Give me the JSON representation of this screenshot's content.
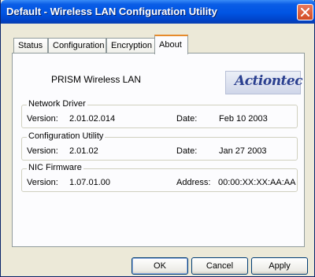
{
  "window": {
    "title": "Default - Wireless LAN Configuration Utility"
  },
  "tabs": [
    {
      "label": "Status"
    },
    {
      "label": "Configuration"
    },
    {
      "label": "Encryption"
    },
    {
      "label": "About"
    }
  ],
  "about": {
    "product_name": "PRISM Wireless LAN",
    "logo_text": "Actiontec",
    "network_driver": {
      "legend": "Network Driver",
      "version_label": "Version:",
      "version_value": "2.01.02.014",
      "date_label": "Date:",
      "date_value": "Feb 10 2003"
    },
    "configuration_utility": {
      "legend": "Configuration Utility",
      "version_label": "Version:",
      "version_value": "2.01.02",
      "date_label": "Date:",
      "date_value": "Jan 27 2003"
    },
    "nic_firmware": {
      "legend": "NIC Firmware",
      "version_label": "Version:",
      "version_value": "1.07.01.00",
      "address_label": "Address:",
      "address_value": "00:00:XX:XX:AA:AA"
    }
  },
  "buttons": {
    "ok": "OK",
    "cancel": "Cancel",
    "apply": "Apply"
  },
  "colors": {
    "titlebar": "#0054e3",
    "active_tab_accent": "#e68b2c",
    "dialog_face": "#ece9d8"
  }
}
